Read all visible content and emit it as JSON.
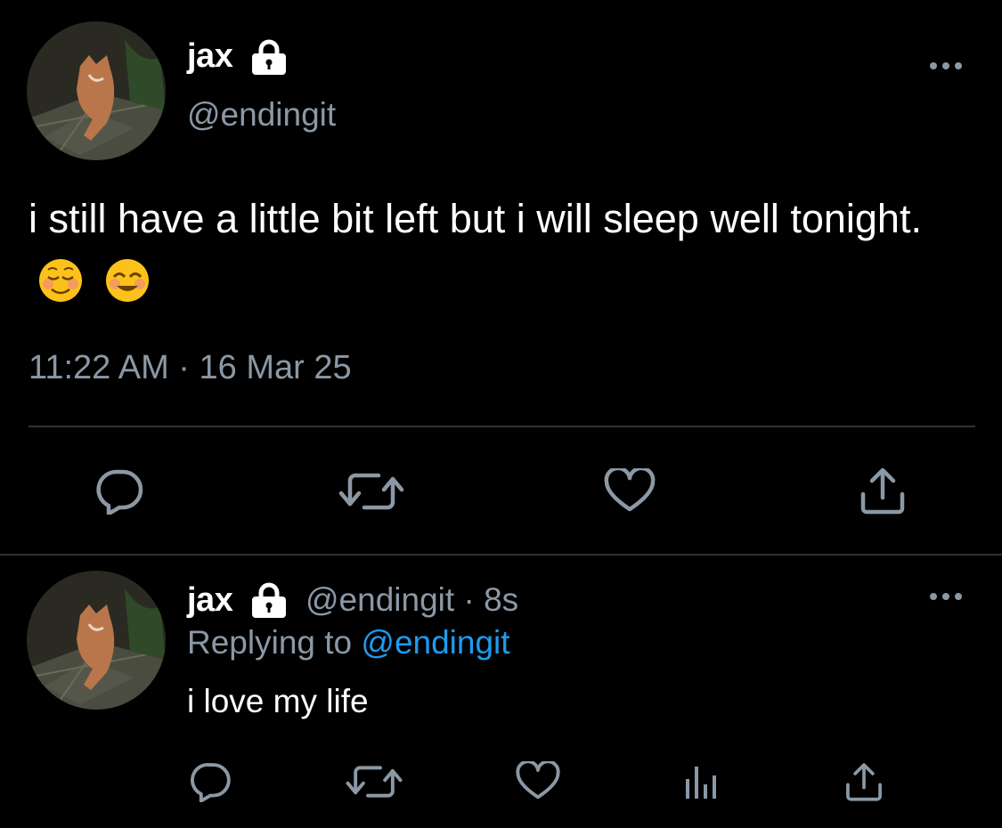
{
  "main_tweet": {
    "display_name": "jax",
    "handle": "@endingit",
    "text": "i still have a little bit left but i will sleep well tonight.",
    "emojis": [
      "☺️",
      "😊"
    ],
    "timestamp": "11:22 AM · 16 Mar 25",
    "lock_icon": "lock-icon",
    "actions": [
      "reply-icon",
      "retweet-icon",
      "like-icon",
      "share-icon"
    ]
  },
  "reply_tweet": {
    "display_name": "jax",
    "handle": "@endingit",
    "separator": "·",
    "time": "8s",
    "replying_label": "Replying to",
    "replying_to": "@endingit",
    "text": "i love my life",
    "actions": [
      "reply-icon",
      "retweet-icon",
      "like-icon",
      "analytics-icon",
      "share-icon"
    ]
  },
  "colors": {
    "background": "#000000",
    "text": "#ffffff",
    "muted": "#8b98a5",
    "accent": "#1d9bf0",
    "divider": "#2f3336"
  }
}
